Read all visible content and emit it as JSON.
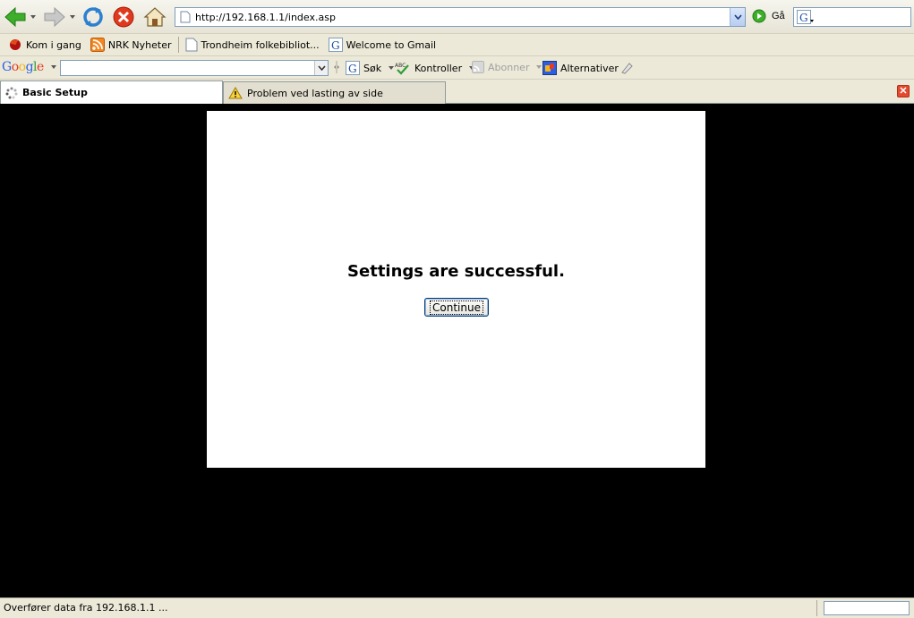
{
  "nav": {
    "url": "http://192.168.1.1/index.asp",
    "go_label": "Gå"
  },
  "bookmarks": [
    {
      "label": "Kom i gang",
      "icon": "firefox-icon"
    },
    {
      "label": "NRK Nyheter",
      "icon": "rss-feed-icon"
    },
    {
      "label": "Trondheim folkebibliot...",
      "icon": "page-icon"
    },
    {
      "label": "Welcome to Gmail",
      "icon": "google-g-icon"
    }
  ],
  "google_toolbar": {
    "logo": "Google",
    "search_label": "Søk",
    "check_label": "Kontroller",
    "subscribe_label": "Abonner",
    "options_label": "Alternativer"
  },
  "tabs": [
    {
      "label": "Basic Setup",
      "active": true,
      "icon": "loading-spinner-icon"
    },
    {
      "label": "Problem ved lasting av side",
      "active": false,
      "icon": "warning-icon"
    }
  ],
  "page": {
    "message": "Settings are successful.",
    "continue_label": "Continue"
  },
  "status": {
    "text": "Overfører data fra 192.168.1.1 ..."
  },
  "colors": {
    "page_background": "#000000",
    "panel_background": "#ffffff",
    "tab_close": "#e44a2f"
  }
}
